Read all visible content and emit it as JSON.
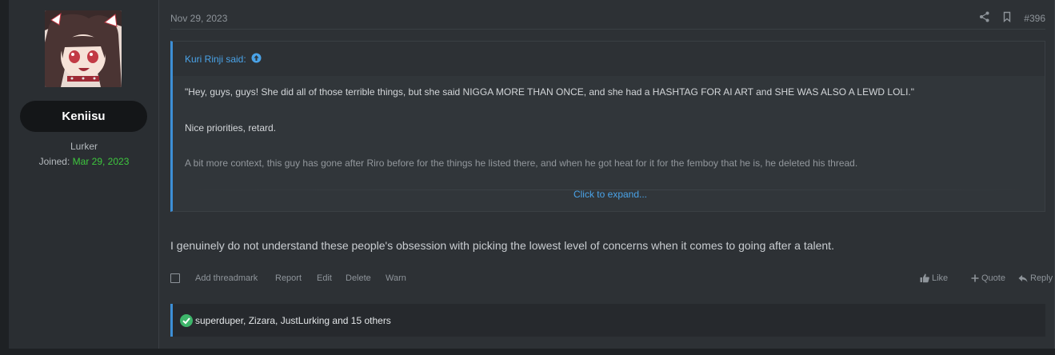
{
  "user": {
    "name": "Keniisu",
    "title": "Lurker",
    "joined_label": "Joined:",
    "joined_date": "Mar 29, 2023"
  },
  "post": {
    "date": "Nov 29, 2023",
    "number": "#396",
    "body": "I genuinely do not understand these people's obsession with picking the lowest level of concerns when it comes to going after a talent."
  },
  "quote": {
    "author": "Kuri Rinji said:",
    "line1": "\"Hey, guys, guys! She did all of those terrible things, but she said NIGGA MORE THAN ONCE, and she had a HASHTAG FOR AI ART and SHE WAS ALSO A LEWD LOLI.\"",
    "line2": "Nice priorities, retard.",
    "line3": "A bit more context, this guy has gone after Riro before for the things he listed there, and when he got heat for it for the femboy that he is, he deleted his thread.",
    "expand_label": "Click to expand..."
  },
  "actions": {
    "add_threadmark": "Add threadmark",
    "report": "Report",
    "edit": "Edit",
    "delete": "Delete",
    "warn": "Warn",
    "like": "Like",
    "quote": "Quote",
    "reply": "Reply"
  },
  "reactions": {
    "text": "superduper, Zizara, JustLurking and 15 others"
  },
  "colors": {
    "accent": "#3d8fd6",
    "joined_date": "#3ec73e",
    "reaction_icon": "#3db56a"
  },
  "icons": [
    "share-icon",
    "bookmark-icon",
    "arrow-up-circle-icon",
    "thumbs-up-icon",
    "plus-icon",
    "reply-icon",
    "checkmark-icon"
  ]
}
